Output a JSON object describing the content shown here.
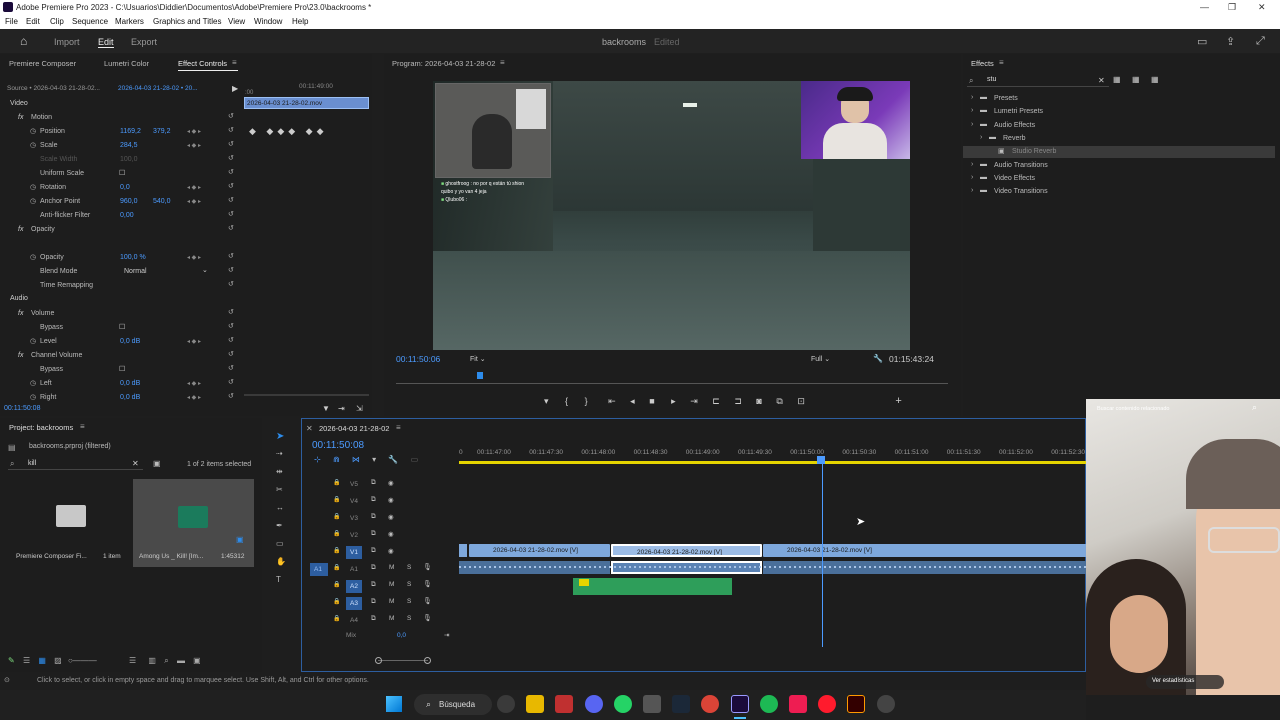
{
  "app": {
    "window_title": "Adobe Premiere Pro 2023 - C:\\Usuarios\\Diddier\\Documentos\\Adobe\\Premiere Pro\\23.0\\backrooms *",
    "project_name": "backrooms",
    "project_state": "Edited"
  },
  "menu": [
    "File",
    "Edit",
    "Clip",
    "Sequence",
    "Markers",
    "Graphics and Titles",
    "View",
    "Window",
    "Help"
  ],
  "workspace_tabs": [
    "Import",
    "Edit",
    "Export"
  ],
  "left_tabs": [
    "Premiere Composer",
    "Lumetri Color",
    "Effect Controls"
  ],
  "effect_controls": {
    "source": "Source • 2026-04-03 21-28-02...",
    "seq": "2026-04-03 21-28-02 • 20...",
    "clip_label": "2026-04-03 21-28-02.mov",
    "video_header": "Video",
    "audio_header": "Audio",
    "time": "00:11:50:08",
    "rows": [
      {
        "label": "Motion",
        "value": "",
        "value2": ""
      },
      {
        "label": "Position",
        "value": "1169,2",
        "value2": "379,2"
      },
      {
        "label": "Scale",
        "value": "284,5",
        "value2": ""
      },
      {
        "label": "Scale Width",
        "value": "100,0",
        "value2": ""
      },
      {
        "label": "Uniform Scale",
        "value": "",
        "value2": ""
      },
      {
        "label": "Rotation",
        "value": "0,0",
        "value2": ""
      },
      {
        "label": "Anchor Point",
        "value": "960,0",
        "value2": "540,0"
      },
      {
        "label": "Anti-flicker Filter",
        "value": "0,00",
        "value2": ""
      },
      {
        "label": "Opacity",
        "value": "",
        "value2": ""
      },
      {
        "label": "Opacity",
        "value": "100,0 %",
        "value2": ""
      },
      {
        "label": "Blend Mode",
        "value": "Normal",
        "value2": ""
      },
      {
        "label": "Time Remapping",
        "value": "",
        "value2": ""
      },
      {
        "label": "Volume",
        "value": "",
        "value2": ""
      },
      {
        "label": "Bypass",
        "value": "",
        "value2": ""
      },
      {
        "label": "Level",
        "value": "0,0 dB",
        "value2": ""
      },
      {
        "label": "Channel Volume",
        "value": "",
        "value2": ""
      },
      {
        "label": "Bypass",
        "value": "",
        "value2": ""
      },
      {
        "label": "Left",
        "value": "0,0 dB",
        "value2": ""
      },
      {
        "label": "Right",
        "value": "0,0 dB",
        "value2": ""
      }
    ]
  },
  "program": {
    "title": "Program: 2026-04-03 21-28-02",
    "current_time": "00:11:50:06",
    "fit": "Fit",
    "full": "Full",
    "duration": "01:15:43:24",
    "overlay_chat1": "ghostfroog : no por q están tú shion",
    "overlay_chat2": "quibo y yo van 4 jeja",
    "overlay_chat3": "Qlubo06 :"
  },
  "effects": {
    "title": "Effects",
    "search": "stu",
    "tree": [
      {
        "label": "Presets",
        "indent": 0
      },
      {
        "label": "Lumetri Presets",
        "indent": 0
      },
      {
        "label": "Audio Effects",
        "indent": 0
      },
      {
        "label": "Reverb",
        "indent": 1
      },
      {
        "label": "Studio Reverb",
        "indent": 2
      },
      {
        "label": "Audio Transitions",
        "indent": 0
      },
      {
        "label": "Video Effects",
        "indent": 0
      },
      {
        "label": "Video Transitions",
        "indent": 0
      }
    ]
  },
  "project": {
    "title": "Project: backrooms",
    "file": "backrooms.prproj (filtered)",
    "search": "kill",
    "selection": "1 of 2 items selected",
    "items": [
      {
        "name": "Premiere Composer Fi...",
        "meta": "1 item"
      },
      {
        "name": "Among Us _ Kill! [Im...",
        "meta": "1:45312"
      }
    ]
  },
  "timeline": {
    "title": "2026-04-03 21-28-02",
    "timecode": "00:11:50:08",
    "ruler": [
      "00:11:47:00",
      "00:11:47:30",
      "00:11:48:00",
      "00:11:48:30",
      "00:11:49:00",
      "00:11:49:30",
      "00:11:50:00",
      "00:11:50:30",
      "00:11:51:00",
      "00:11:51:30",
      "00:11:52:00",
      "00:11:52:30"
    ],
    "video_tracks": [
      "V5",
      "V4",
      "V3",
      "V2",
      "V1"
    ],
    "audio_tracks": [
      "A1",
      "A2",
      "A3",
      "A4"
    ],
    "mix_label": "Mix",
    "mix_value": "0,0",
    "clip_names": [
      "2026-04-03 21-28-02.mov [V]",
      "2026-04-03 21-28-02.mov [V]",
      "2026-04-03 21-28-02.mov [V]"
    ]
  },
  "status_bar": "Click to select, or click in empty space and drag to marquee select. Use Shift, Alt, and Ctrl for other options.",
  "taskbar": {
    "search": "Búsqueda"
  },
  "phone_overlay": {
    "top_text": "Buscar contenido relacionado",
    "button": "Ver estadísticas"
  },
  "colors": {
    "accent": "#2d8ceb",
    "clip_video": "#7ea8dc",
    "clip_audio": "#4a6f9a",
    "clip_green": "#2e9e5a",
    "selection": "#ffffff"
  }
}
